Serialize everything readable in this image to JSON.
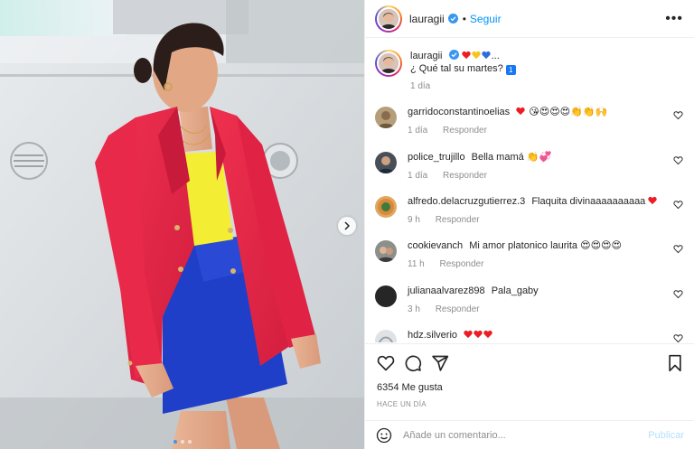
{
  "post": {
    "username": "lauragii",
    "follow_label": "Seguir",
    "separator": "•",
    "more_label": "•••",
    "caption_text": "¿ Qué tal su martes?",
    "caption_ellipsis": "...",
    "caption_emoji": "1",
    "caption_time": "1 día",
    "likes": "6354 Me gusta",
    "posted_ago": "HACE UN DÍA",
    "comment_placeholder": "Añade un comentario...",
    "publish_label": "Publicar",
    "carousel": {
      "slides": 3,
      "active": 1
    }
  },
  "comments": [
    {
      "user": "garridoconstantinoelias",
      "text": "",
      "emoji": "😘😍😍😍👏👏🙌",
      "hearts": 1,
      "time": "1 día",
      "reply": "Responder"
    },
    {
      "user": "police_trujillo",
      "text": "Bella mamá",
      "emoji": "👏💞",
      "hearts": 0,
      "time": "1 día",
      "reply": "Responder"
    },
    {
      "user": "alfredo.delacruzgutierrez.3",
      "text": "Flaquita divinaaaaaaaaaa",
      "emoji": "",
      "hearts": 1,
      "time": "9 h",
      "reply": "Responder"
    },
    {
      "user": "cookievanch",
      "text": "Mi amor platonico laurita",
      "emoji": "😍😍😍😍",
      "hearts": 0,
      "time": "11 h",
      "reply": "Responder"
    },
    {
      "user": "julianaalvarez898",
      "text": "Pala_gaby",
      "emoji": "",
      "hearts": 0,
      "time": "3 h",
      "reply": "Responder"
    },
    {
      "user": "hdz.silverio",
      "text": "",
      "emoji": "",
      "hearts": 3,
      "time": "",
      "reply": ""
    }
  ],
  "icons": {
    "like": "heart-outline-icon",
    "comment": "speech-bubble-icon",
    "share": "paper-plane-icon",
    "save": "bookmark-icon",
    "emoji": "smiley-icon",
    "verified": "verified-badge-icon",
    "next": "chevron-right-icon"
  },
  "colors": {
    "accent": "#0095f6",
    "verified": "#3897f0",
    "heart": "#ed4956",
    "muted": "#8e8e8e",
    "publish_disabled": "#b2dffc",
    "blazer": "#e8294a",
    "top": "#f3ee33",
    "shorts": "#1f3fc8"
  }
}
